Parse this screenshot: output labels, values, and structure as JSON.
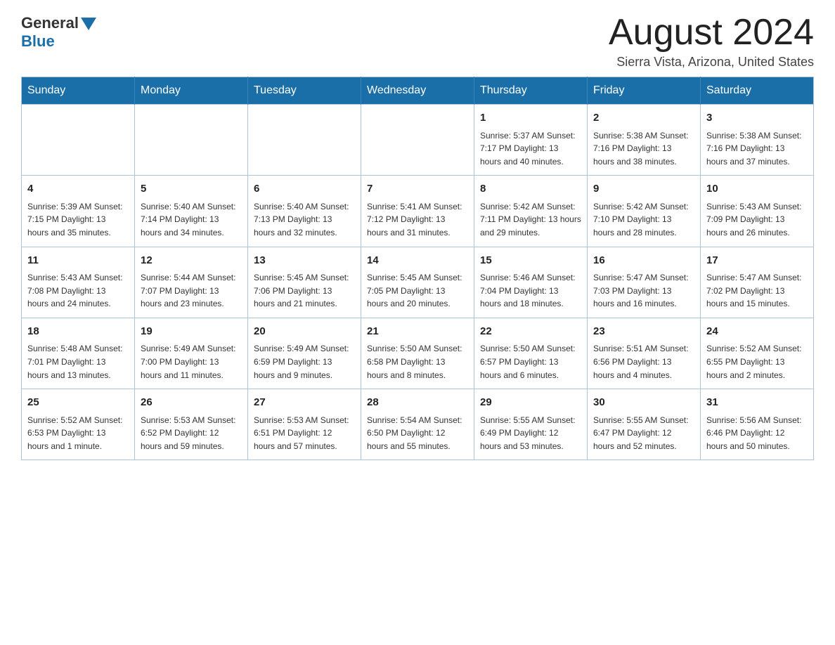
{
  "header": {
    "logo_general": "General",
    "logo_blue": "Blue",
    "month_title": "August 2024",
    "location": "Sierra Vista, Arizona, United States"
  },
  "days_of_week": [
    "Sunday",
    "Monday",
    "Tuesday",
    "Wednesday",
    "Thursday",
    "Friday",
    "Saturday"
  ],
  "weeks": [
    [
      {
        "day": "",
        "info": ""
      },
      {
        "day": "",
        "info": ""
      },
      {
        "day": "",
        "info": ""
      },
      {
        "day": "",
        "info": ""
      },
      {
        "day": "1",
        "info": "Sunrise: 5:37 AM\nSunset: 7:17 PM\nDaylight: 13 hours and 40 minutes."
      },
      {
        "day": "2",
        "info": "Sunrise: 5:38 AM\nSunset: 7:16 PM\nDaylight: 13 hours and 38 minutes."
      },
      {
        "day": "3",
        "info": "Sunrise: 5:38 AM\nSunset: 7:16 PM\nDaylight: 13 hours and 37 minutes."
      }
    ],
    [
      {
        "day": "4",
        "info": "Sunrise: 5:39 AM\nSunset: 7:15 PM\nDaylight: 13 hours and 35 minutes."
      },
      {
        "day": "5",
        "info": "Sunrise: 5:40 AM\nSunset: 7:14 PM\nDaylight: 13 hours and 34 minutes."
      },
      {
        "day": "6",
        "info": "Sunrise: 5:40 AM\nSunset: 7:13 PM\nDaylight: 13 hours and 32 minutes."
      },
      {
        "day": "7",
        "info": "Sunrise: 5:41 AM\nSunset: 7:12 PM\nDaylight: 13 hours and 31 minutes."
      },
      {
        "day": "8",
        "info": "Sunrise: 5:42 AM\nSunset: 7:11 PM\nDaylight: 13 hours and 29 minutes."
      },
      {
        "day": "9",
        "info": "Sunrise: 5:42 AM\nSunset: 7:10 PM\nDaylight: 13 hours and 28 minutes."
      },
      {
        "day": "10",
        "info": "Sunrise: 5:43 AM\nSunset: 7:09 PM\nDaylight: 13 hours and 26 minutes."
      }
    ],
    [
      {
        "day": "11",
        "info": "Sunrise: 5:43 AM\nSunset: 7:08 PM\nDaylight: 13 hours and 24 minutes."
      },
      {
        "day": "12",
        "info": "Sunrise: 5:44 AM\nSunset: 7:07 PM\nDaylight: 13 hours and 23 minutes."
      },
      {
        "day": "13",
        "info": "Sunrise: 5:45 AM\nSunset: 7:06 PM\nDaylight: 13 hours and 21 minutes."
      },
      {
        "day": "14",
        "info": "Sunrise: 5:45 AM\nSunset: 7:05 PM\nDaylight: 13 hours and 20 minutes."
      },
      {
        "day": "15",
        "info": "Sunrise: 5:46 AM\nSunset: 7:04 PM\nDaylight: 13 hours and 18 minutes."
      },
      {
        "day": "16",
        "info": "Sunrise: 5:47 AM\nSunset: 7:03 PM\nDaylight: 13 hours and 16 minutes."
      },
      {
        "day": "17",
        "info": "Sunrise: 5:47 AM\nSunset: 7:02 PM\nDaylight: 13 hours and 15 minutes."
      }
    ],
    [
      {
        "day": "18",
        "info": "Sunrise: 5:48 AM\nSunset: 7:01 PM\nDaylight: 13 hours and 13 minutes."
      },
      {
        "day": "19",
        "info": "Sunrise: 5:49 AM\nSunset: 7:00 PM\nDaylight: 13 hours and 11 minutes."
      },
      {
        "day": "20",
        "info": "Sunrise: 5:49 AM\nSunset: 6:59 PM\nDaylight: 13 hours and 9 minutes."
      },
      {
        "day": "21",
        "info": "Sunrise: 5:50 AM\nSunset: 6:58 PM\nDaylight: 13 hours and 8 minutes."
      },
      {
        "day": "22",
        "info": "Sunrise: 5:50 AM\nSunset: 6:57 PM\nDaylight: 13 hours and 6 minutes."
      },
      {
        "day": "23",
        "info": "Sunrise: 5:51 AM\nSunset: 6:56 PM\nDaylight: 13 hours and 4 minutes."
      },
      {
        "day": "24",
        "info": "Sunrise: 5:52 AM\nSunset: 6:55 PM\nDaylight: 13 hours and 2 minutes."
      }
    ],
    [
      {
        "day": "25",
        "info": "Sunrise: 5:52 AM\nSunset: 6:53 PM\nDaylight: 13 hours and 1 minute."
      },
      {
        "day": "26",
        "info": "Sunrise: 5:53 AM\nSunset: 6:52 PM\nDaylight: 12 hours and 59 minutes."
      },
      {
        "day": "27",
        "info": "Sunrise: 5:53 AM\nSunset: 6:51 PM\nDaylight: 12 hours and 57 minutes."
      },
      {
        "day": "28",
        "info": "Sunrise: 5:54 AM\nSunset: 6:50 PM\nDaylight: 12 hours and 55 minutes."
      },
      {
        "day": "29",
        "info": "Sunrise: 5:55 AM\nSunset: 6:49 PM\nDaylight: 12 hours and 53 minutes."
      },
      {
        "day": "30",
        "info": "Sunrise: 5:55 AM\nSunset: 6:47 PM\nDaylight: 12 hours and 52 minutes."
      },
      {
        "day": "31",
        "info": "Sunrise: 5:56 AM\nSunset: 6:46 PM\nDaylight: 12 hours and 50 minutes."
      }
    ]
  ]
}
